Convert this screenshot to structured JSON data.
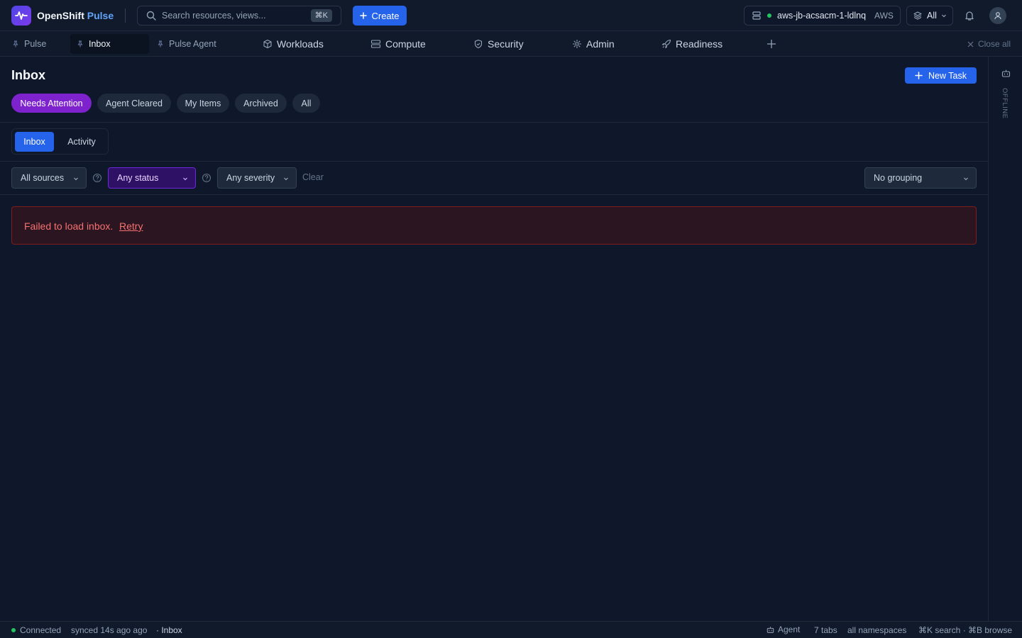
{
  "app": {
    "brand_primary": "OpenShift",
    "brand_accent": "Pulse"
  },
  "search": {
    "placeholder": "Search resources, views...",
    "shortcut": "⌘K"
  },
  "header": {
    "create_label": "Create",
    "cluster_name": "aws-jb-acsacm-1-ldlnq",
    "cluster_provider": "AWS",
    "namespace_label": "All"
  },
  "tabs": [
    {
      "label": "Pulse"
    },
    {
      "label": "Inbox"
    },
    {
      "label": "Pulse Agent"
    },
    {
      "label": "Workloads"
    },
    {
      "label": "Compute"
    },
    {
      "label": "Security"
    },
    {
      "label": "Admin"
    },
    {
      "label": "Readiness"
    }
  ],
  "tabbar": {
    "close_all_label": "Close all"
  },
  "page": {
    "title": "Inbox",
    "new_task_label": "New Task",
    "filter_chips": [
      {
        "label": "Needs Attention"
      },
      {
        "label": "Agent Cleared"
      },
      {
        "label": "My Items"
      },
      {
        "label": "Archived"
      },
      {
        "label": "All"
      }
    ],
    "view_toggle": [
      {
        "label": "Inbox"
      },
      {
        "label": "Activity"
      }
    ],
    "filters": {
      "sources": "All sources",
      "status": "Any status",
      "severity": "Any severity",
      "clear_label": "Clear",
      "grouping": "No grouping"
    },
    "error": {
      "message": "Failed to load inbox.",
      "retry_label": "Retry"
    }
  },
  "right_rail": {
    "status_label": "OFFLINE"
  },
  "statusbar": {
    "connection": "Connected",
    "synced": "synced 14s ago ago",
    "location": "· Inbox",
    "agent_label": "Agent",
    "tabs_count": "7 tabs",
    "namespaces": "all namespaces",
    "shortcuts": "⌘K search · ⌘B browse"
  },
  "colors": {
    "accent": "#2563eb",
    "brand_accent": "#60a5fa",
    "chip_active": "#7e22ce",
    "error": "#f87171",
    "success": "#22c55e"
  }
}
